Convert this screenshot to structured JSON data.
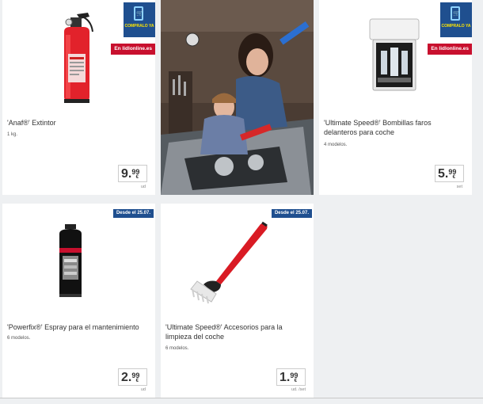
{
  "products": [
    {
      "title": "'Anaf®' Extintor",
      "subtitle": "1 kg.",
      "price_int": "9.",
      "price_dec": "99",
      "currency": "€",
      "unit": "ud",
      "badge": "COMPRALO YA",
      "tag": "En lidlonline.es"
    },
    {
      "title": "'Ultimate Speed®' Bombillas faros delanteros para coche",
      "subtitle": "4 modelos.",
      "price_int": "5.",
      "price_dec": "99",
      "currency": "€",
      "unit": "set",
      "badge": "COMPRALO YA",
      "tag": "En lidlonline.es"
    },
    {
      "title": "'Powerfix®' Espray para el mantenimiento",
      "subtitle": "6 modelos.",
      "price_int": "2.",
      "price_dec": "99",
      "currency": "€",
      "unit": "ud",
      "tag": "Desde el 25.07."
    },
    {
      "title": "'Ultimate Speed®' Accesorios para la limpieza del coche",
      "subtitle": "6 modelos.",
      "price_int": "1.",
      "price_dec": "99",
      "currency": "€",
      "unit": "ud. /set",
      "tag": "Desde el 25.07."
    }
  ],
  "promo_image": {
    "alt": "Mother and child repairing a car engine in a garage"
  }
}
